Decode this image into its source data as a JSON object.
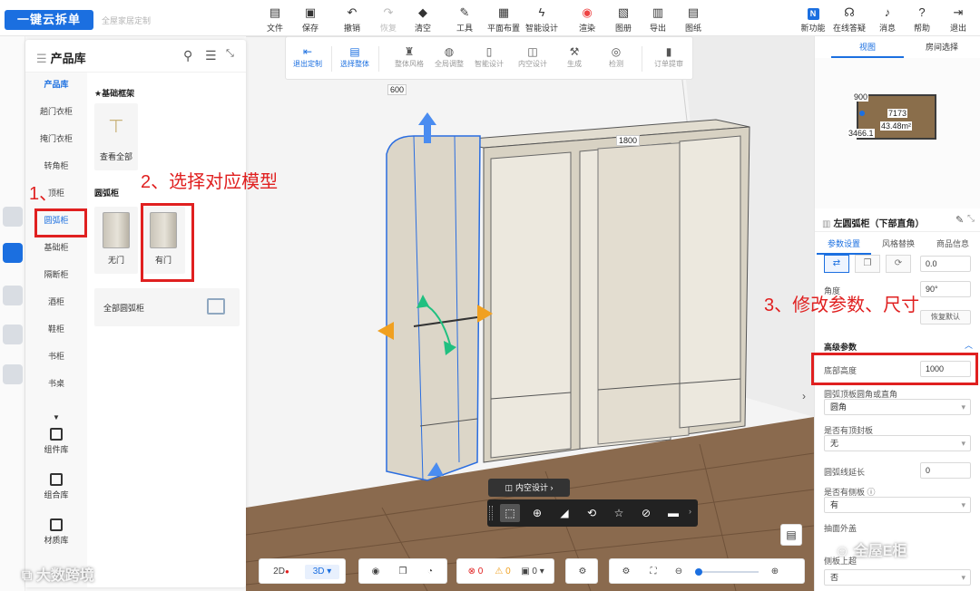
{
  "app": {
    "logo_text": "一键云拆单",
    "subtitle": "全屋家居定制"
  },
  "toolbar": {
    "items": [
      {
        "label": "文件",
        "icon": "file-icon"
      },
      {
        "label": "保存",
        "icon": "save-icon"
      },
      {
        "label": "撤销",
        "icon": "undo-icon"
      },
      {
        "label": "恢复",
        "icon": "redo-icon"
      },
      {
        "label": "清空",
        "icon": "eraser-icon"
      },
      {
        "label": "工具",
        "icon": "wrench-icon"
      },
      {
        "label": "平面布置",
        "icon": "floor-plan-icon"
      },
      {
        "label": "智能设计",
        "icon": "lightning-icon"
      },
      {
        "label": "渲染",
        "icon": "render-icon"
      },
      {
        "label": "图册",
        "icon": "album-icon"
      },
      {
        "label": "导出",
        "icon": "export-icon"
      },
      {
        "label": "图纸",
        "icon": "drawing-icon"
      }
    ],
    "right_items": [
      {
        "label": "新功能",
        "icon": "new-feature-icon",
        "badge": "N"
      },
      {
        "label": "在线答疑",
        "icon": "headset-icon"
      },
      {
        "label": "消息",
        "icon": "bell-icon"
      },
      {
        "label": "帮助",
        "icon": "help-icon"
      },
      {
        "label": "退出",
        "icon": "exit-icon"
      }
    ]
  },
  "design_toolbar": {
    "items": [
      {
        "label": "退出定制",
        "icon": "exit-custom-icon"
      },
      {
        "label": "选择整体",
        "icon": "select-all-icon"
      },
      {
        "label": "整体风格",
        "icon": "style-icon"
      },
      {
        "label": "全局调整",
        "icon": "global-adjust-icon"
      },
      {
        "label": "智能设计",
        "icon": "smart-design-icon"
      },
      {
        "label": "内空设计",
        "icon": "inner-space-icon"
      },
      {
        "label": "生成",
        "icon": "generate-icon"
      },
      {
        "label": "检测",
        "icon": "check-icon"
      },
      {
        "label": "订单提审",
        "icon": "order-icon"
      }
    ]
  },
  "library": {
    "title": "产品库",
    "categories": [
      "产品库",
      "趟门衣柜",
      "掩门衣柜",
      "转角柜",
      "顶柜",
      "圆弧柜",
      "基础柜",
      "隔断柜",
      "酒柜",
      "鞋柜",
      "书柜",
      "书桌"
    ],
    "tools": [
      "组件库",
      "组合库",
      "材质库"
    ],
    "section_basic": "★基础框架",
    "view_all": "查看全部",
    "section_arc": "圆弧柜",
    "arc_items": [
      "无门",
      "有门"
    ],
    "all_arc": "全部圆弧柜"
  },
  "canvas": {
    "dim_600": "600",
    "dim_1800": "1800"
  },
  "context": {
    "label": "内空设计 ›"
  },
  "bottom": {
    "mode_2d": "2D",
    "mode_3d": "3D",
    "error_count": "0",
    "warning_count": "0",
    "info_count": "0"
  },
  "right_top": {
    "tab_view": "视图",
    "tab_room": "房间选择",
    "dim_900": "900",
    "dim_7173": "7173",
    "area": "43.48m²",
    "dim_3466": "3466.1"
  },
  "props": {
    "title": "左圆弧柜（下部直角）",
    "tabs": [
      "参数设置",
      "风格替换",
      "商品信息"
    ],
    "value_0": "0.0",
    "angle_label": "角度",
    "angle_value": "90°",
    "reset_label": "恢复默认",
    "advanced_title": "高级参数",
    "bottom_height_label": "底部高度",
    "bottom_height_value": "1000",
    "arc_corner_label": "圆弧顶板圆角或直角",
    "arc_corner_value": "圆角",
    "top_board_label": "是否有顶封板",
    "top_board_value": "无",
    "arc_extend_label": "圆弧线延长",
    "arc_extend_value": "0",
    "side_board_label": "是否有侧板 ⓘ",
    "side_board_value": "有",
    "cover_label": "抽面外盖",
    "side_top_label": "侧板上超",
    "side_top_value": "否"
  },
  "annotations": {
    "step1": "1、",
    "step2": "2、选择对应模型",
    "step3": "3、修改参数、尺寸"
  },
  "watermarks": {
    "left": "大数跨境",
    "right": "全屋E柜"
  },
  "colors": {
    "accent": "#1b6fe0",
    "annotation": "#e02020",
    "selection": "#2a6de0",
    "gizmo_blue": "#4a8cf0",
    "gizmo_orange": "#f0a020",
    "gizmo_green": "#20c080"
  }
}
